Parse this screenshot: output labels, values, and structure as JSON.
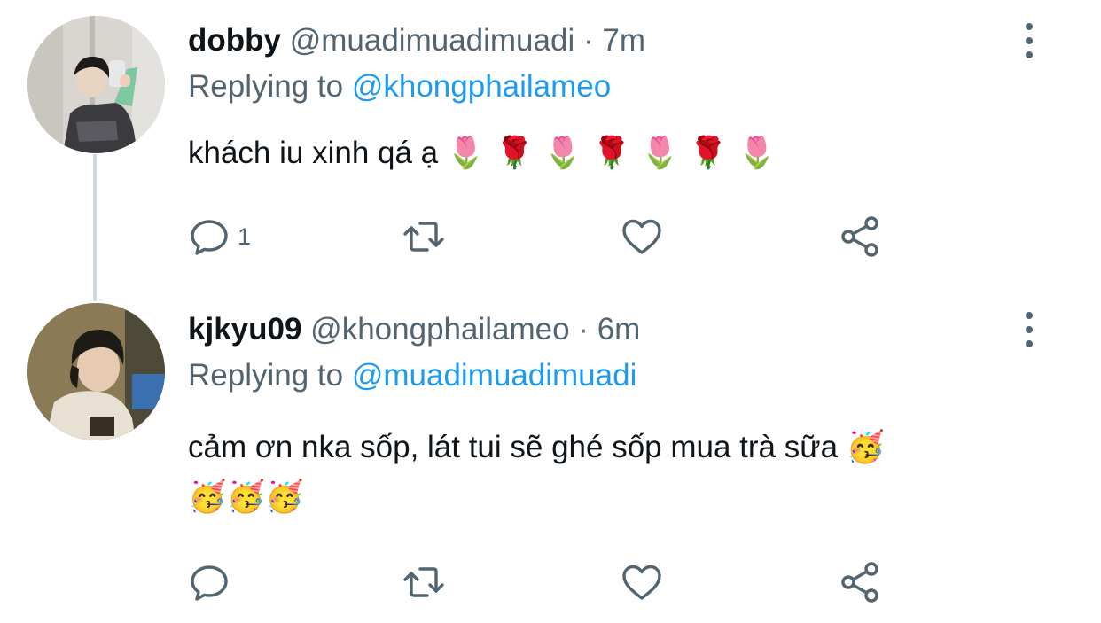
{
  "tweets": [
    {
      "display_name": "dobby",
      "handle": "@muadimuadimuadi",
      "separator": "·",
      "time": "7m",
      "replying_label": "Replying to",
      "replying_to": "@khongphailameo",
      "text": "khách iu xinh qá ạ",
      "emojis": "🌷 🌹 🌷 🌹 🌷 🌹 🌷",
      "reply_count": "1"
    },
    {
      "display_name": "kjkyu09",
      "handle": "@khongphailameo",
      "separator": "·",
      "time": "6m",
      "replying_label": "Replying to",
      "replying_to": "@muadimuadimuadi",
      "text": "cảm ơn nka sốp, lát tui sẽ ghé sốp mua trà sữa",
      "emojis_inline": "🥳",
      "emojis_line2": "🥳🥳🥳",
      "reply_count": ""
    }
  ],
  "colors": {
    "text": "#0f1419",
    "secondary": "#536471",
    "link": "#1d9bf0",
    "thread_line": "#cfd9de"
  },
  "icons": [
    "comment-icon",
    "retweet-icon",
    "heart-icon",
    "share-icon",
    "more-icon"
  ]
}
